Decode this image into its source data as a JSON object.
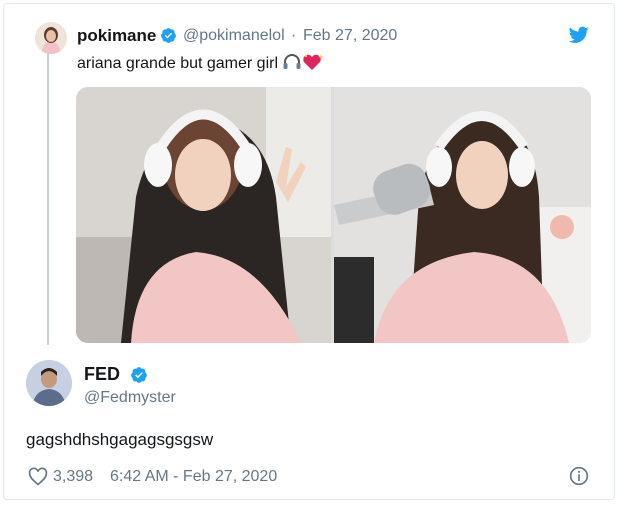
{
  "colors": {
    "twitter_blue": "#1da1f2",
    "text_primary": "#14171a",
    "text_secondary": "#657786",
    "border": "#e1e8ed"
  },
  "quoted_tweet": {
    "name": "pokimane",
    "handle": "@pokimanelol",
    "separator": "·",
    "date": "Feb 27, 2020",
    "text": "ariana grande but gamer girl",
    "emojis": [
      "headphone-emoji",
      "sparkling-heart-emoji"
    ],
    "verified": true
  },
  "reply_tweet": {
    "name": "FED",
    "handle": "@Fedmyster",
    "text": "gagshdhshgagagsgsgsw",
    "verified": true,
    "likes": "3,398",
    "timestamp": "6:42 AM - Feb 27, 2020"
  },
  "icons": {
    "brand": "twitter-bird-icon",
    "like": "heart-icon",
    "info": "info-icon",
    "verified": "verified-badge-icon"
  }
}
